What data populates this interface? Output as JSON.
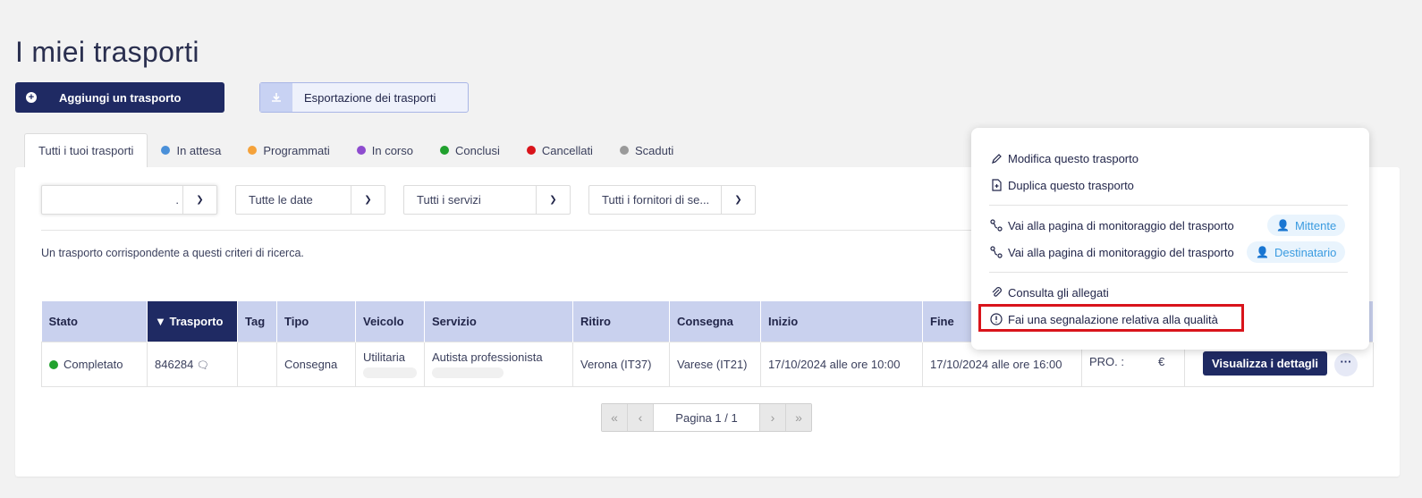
{
  "page": {
    "title": "I miei trasporti"
  },
  "actions": {
    "add_label": "Aggiungi un trasporto",
    "export_label": "Esportazione dei trasporti"
  },
  "tabs": [
    {
      "label": "Tutti i tuoi trasporti",
      "color": ""
    },
    {
      "label": "In attesa",
      "color": "#4a90d9"
    },
    {
      "label": "Programmati",
      "color": "#f5a23a"
    },
    {
      "label": "In corso",
      "color": "#8e4ccf"
    },
    {
      "label": "Conclusi",
      "color": "#21a12e"
    },
    {
      "label": "Cancellati",
      "color": "#d9141b"
    },
    {
      "label": "Scaduti",
      "color": "#9a9a9a"
    }
  ],
  "filters": {
    "search_value": ".",
    "dates": "Tutte le date",
    "services": "Tutti i servizi",
    "providers": "Tutti i fornitori di se..."
  },
  "result_text": "Un trasporto corrispondente a questi criteri di ricerca.",
  "table": {
    "headers": [
      "Stato",
      "▼ Trasporto",
      "Tag",
      "Tipo",
      "Veicolo",
      "Servizio",
      "Ritiro",
      "Consegna",
      "Inizio",
      "Fine",
      "",
      ""
    ],
    "row": {
      "stato": "Completato",
      "trasporto": "846284",
      "tag": "",
      "tipo": "Consegna",
      "veicolo": "Utilitaria",
      "servizio": "Autista professionista",
      "ritiro": "Verona (IT37)",
      "consegna": "Varese (IT21)",
      "inizio": "17/10/2024 alle ore 10:00",
      "fine": "17/10/2024 alle ore 16:00",
      "prezzo_prefix": "PRO. :",
      "prezzo_suffix": "€",
      "details_label": "Visualizza i dettagli",
      "more_label": "···"
    }
  },
  "pager": {
    "info": "Pagina 1 / 1"
  },
  "menu": {
    "edit": "Modifica questo trasporto",
    "duplicate": "Duplica questo trasporto",
    "monitor_sender": "Vai alla pagina di monitoraggio del trasporto",
    "sender_badge": "Mittente",
    "monitor_recipient": "Vai alla pagina di monitoraggio del trasporto",
    "recipient_badge": "Destinatario",
    "attachments": "Consulta gli allegati",
    "quality": "Fai una segnalazione relativa alla qualità"
  },
  "colors": {
    "primary": "#1f2a63",
    "header_bg": "#c9d1ee",
    "highlight": "#d9141b",
    "badge_text": "#3a9be0"
  }
}
